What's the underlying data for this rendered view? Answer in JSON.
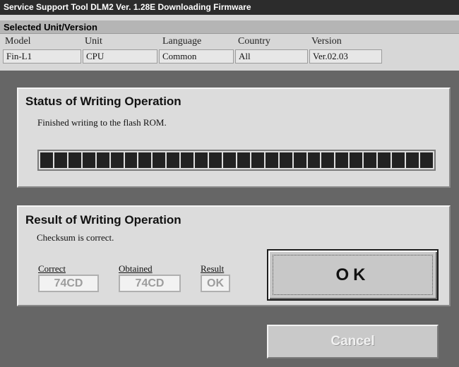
{
  "window": {
    "title": "Service Support Tool DLM2 Ver. 1.28E  Downloading Firmware"
  },
  "unit": {
    "section_title": "Selected Unit/Version",
    "columns": [
      {
        "label": "Model",
        "value": "Fin-L1"
      },
      {
        "label": "Unit",
        "value": "CPU"
      },
      {
        "label": "Language",
        "value": "Common"
      },
      {
        "label": "Country",
        "value": "All"
      },
      {
        "label": "Version",
        "value": "Ver.02.03"
      }
    ]
  },
  "status": {
    "heading": "Status of Writing Operation",
    "message": "Finished writing to the flash ROM.",
    "progress": 1.0
  },
  "result": {
    "heading": "Result of Writing Operation",
    "message": "Checksum is correct.",
    "correct_label": "Correct",
    "correct_value": "74CD",
    "obtained_label": "Obtained",
    "obtained_value": "74CD",
    "result_label": "Result",
    "result_value": "OK"
  },
  "buttons": {
    "ok_label": "OK",
    "cancel_label": "Cancel"
  }
}
